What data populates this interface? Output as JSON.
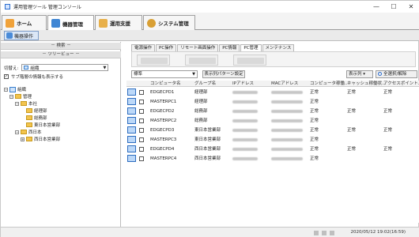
{
  "window": {
    "title": "運用管理ツール 管理コンソール",
    "controls": [
      "—",
      "☐",
      "✕"
    ]
  },
  "main_tabs": [
    {
      "label": "ホーム",
      "icon": "home-icon"
    },
    {
      "label": "機器管理",
      "icon": "devices-icon"
    },
    {
      "label": "運用支援",
      "icon": "support-icon"
    },
    {
      "label": "システム管理",
      "icon": "system-gear-icon"
    }
  ],
  "sub_toolbar": {
    "active": "機器操作"
  },
  "left": {
    "search_bar": "－ 検索 －",
    "tree_bar": "－ ツリービュー －",
    "switch_label": "切替え:",
    "switch_value": "組織",
    "show_sublevel_label": "サブ階層の情報も表示する",
    "show_sublevel_checked": true,
    "tree": [
      {
        "label": "組織",
        "level": 0,
        "glyph": "−",
        "icon": "org"
      },
      {
        "label": "管理",
        "level": 1,
        "glyph": "−",
        "icon": "folder"
      },
      {
        "label": "本社",
        "level": 2,
        "glyph": "−",
        "icon": "folder"
      },
      {
        "label": "経理部",
        "level": 3,
        "glyph": "",
        "icon": "folder"
      },
      {
        "label": "総務部",
        "level": 3,
        "glyph": "",
        "icon": "folder"
      },
      {
        "label": "東日本営業部",
        "level": 3,
        "glyph": "",
        "icon": "folder"
      },
      {
        "label": "西日本",
        "level": 2,
        "glyph": "−",
        "icon": "folder"
      },
      {
        "label": "西日本営業部",
        "level": 3,
        "glyph": "+",
        "icon": "folder"
      }
    ]
  },
  "function_tabs": [
    "電源操作",
    "PC操作",
    "リモート画面操作",
    "PC情報",
    "PC管理",
    "メンテナンス"
  ],
  "function_tab_active": 4,
  "filter": {
    "select_value": "標準",
    "pattern_button": "表示列パターン設定",
    "display_button": "表示列 ▾",
    "select_all_button": "全選択/解除"
  },
  "grid": {
    "columns": [
      "コンピュータ名",
      "グループ名",
      "IPアドレス",
      "MACアドレス",
      "コンピュータ稼働...",
      "キャッシュ稼働状...",
      "アクセスポイント..."
    ],
    "rows": [
      {
        "name": "EDGECPD1",
        "group": "経理部",
        "status": "正常",
        "cache": "正常",
        "ap": "正常"
      },
      {
        "name": "MASTERPC1",
        "group": "経理部",
        "status": "正常",
        "cache": "",
        "ap": ""
      },
      {
        "name": "EDGECPD2",
        "group": "総務部",
        "status": "正常",
        "cache": "正常",
        "ap": "正常"
      },
      {
        "name": "MASTERPC2",
        "group": "総務部",
        "status": "正常",
        "cache": "",
        "ap": ""
      },
      {
        "name": "EDGECPD3",
        "group": "東日本営業部",
        "status": "正常",
        "cache": "正常",
        "ap": "正常"
      },
      {
        "name": "MASTERPC3",
        "group": "東日本営業部",
        "status": "正常",
        "cache": "",
        "ap": ""
      },
      {
        "name": "EDGECPD4",
        "group": "西日本営業部",
        "status": "正常",
        "cache": "正常",
        "ap": "正常"
      },
      {
        "name": "MASTERPC4",
        "group": "西日本営業部",
        "status": "正常",
        "cache": "",
        "ap": ""
      }
    ]
  },
  "status": {
    "timestamp": "2020/05/12 19:02(16:59)"
  },
  "colors": {
    "accent": "#2a6ccf",
    "folder": "#f3c44d",
    "active_tab_bg": "#ffffff"
  }
}
